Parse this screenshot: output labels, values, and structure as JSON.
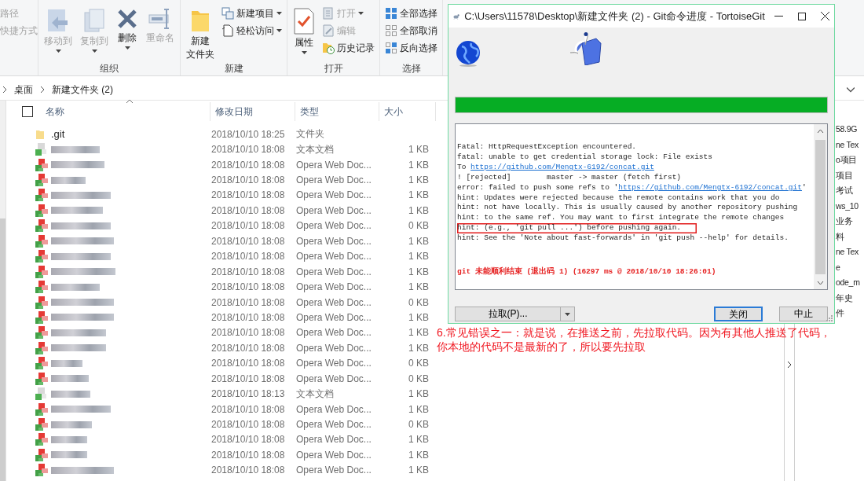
{
  "ribbon": {
    "groups": [
      {
        "items": [
          {
            "label": "路径",
            "kind": "small",
            "disabled": true,
            "dropdown": false
          },
          {
            "label": "快捷方式",
            "kind": "small",
            "disabled": true,
            "dropdown": false
          }
        ]
      },
      {
        "label": "组织",
        "items": [
          {
            "label": "移动到",
            "kind": "large",
            "disabled": true,
            "dropdown": true
          },
          {
            "label": "复制到",
            "kind": "large",
            "disabled": true,
            "dropdown": true
          },
          {
            "label": "删除",
            "kind": "large",
            "disabled": false,
            "dropdown": true
          },
          {
            "label": "重命名",
            "kind": "large",
            "disabled": true,
            "dropdown": false
          }
        ]
      },
      {
        "label": "新建",
        "items": [
          {
            "lines": [
              "新建",
              "文件夹"
            ],
            "kind": "large",
            "disabled": false,
            "dropdown": false
          },
          {
            "label": "新建项目",
            "kind": "small",
            "disabled": false,
            "dropdown": true
          },
          {
            "label": "轻松访问",
            "kind": "small",
            "disabled": false,
            "dropdown": true
          }
        ]
      },
      {
        "label": "打开",
        "items": [
          {
            "label": "属性",
            "kind": "large",
            "disabled": false,
            "dropdown": true
          },
          {
            "label": "打开",
            "kind": "small",
            "disabled": true,
            "dropdown": true
          },
          {
            "label": "编辑",
            "kind": "small",
            "disabled": true,
            "dropdown": false
          },
          {
            "label": "历史记录",
            "kind": "small",
            "disabled": false,
            "dropdown": false
          }
        ]
      },
      {
        "label": "选择",
        "items": [
          {
            "label": "全部选择",
            "kind": "small",
            "disabled": false,
            "dropdown": false
          },
          {
            "label": "全部取消",
            "kind": "small",
            "disabled": false,
            "dropdown": false
          },
          {
            "label": "反向选择",
            "kind": "small",
            "disabled": false,
            "dropdown": false
          }
        ]
      }
    ]
  },
  "breadcrumb": [
    "桌面",
    "新建文件夹 (2)"
  ],
  "table": {
    "select_all": {
      "checked": false
    },
    "columns": [
      {
        "label": "名称",
        "sorted": true
      },
      {
        "label": "修改日期",
        "sorted": false
      },
      {
        "label": "类型",
        "sorted": false
      },
      {
        "label": "大小",
        "sorted": false
      }
    ],
    "rows": [
      {
        "kind": "folder",
        "name": ".git",
        "modified": "2018/10/10 18:25",
        "type": "文件夹"
      },
      {
        "kind": "text",
        "modified": "2018/10/10 18:08",
        "type": "文本文档",
        "size": "1 KB"
      },
      {
        "kind": "web",
        "modified": "2018/10/10 18:08",
        "type": "Opera Web Doc...",
        "size": "1 KB"
      },
      {
        "kind": "web",
        "modified": "2018/10/10 18:08",
        "type": "Opera Web Doc...",
        "size": "1 KB"
      },
      {
        "kind": "web",
        "modified": "2018/10/10 18:08",
        "type": "Opera Web Doc...",
        "size": "1 KB"
      },
      {
        "kind": "web",
        "modified": "2018/10/10 18:08",
        "type": "Opera Web Doc...",
        "size": "1 KB"
      },
      {
        "kind": "web",
        "modified": "2018/10/10 18:08",
        "type": "Opera Web Doc...",
        "size": "0 KB"
      },
      {
        "kind": "web",
        "modified": "2018/10/10 18:08",
        "type": "Opera Web Doc...",
        "size": "1 KB"
      },
      {
        "kind": "web",
        "modified": "2018/10/10 18:08",
        "type": "Opera Web Doc...",
        "size": "1 KB"
      },
      {
        "kind": "web",
        "modified": "2018/10/10 18:08",
        "type": "Opera Web Doc...",
        "size": "1 KB"
      },
      {
        "kind": "web",
        "modified": "2018/10/10 18:08",
        "type": "Opera Web Doc...",
        "size": "1 KB"
      },
      {
        "kind": "web",
        "modified": "2018/10/10 18:08",
        "type": "Opera Web Doc...",
        "size": "0 KB"
      },
      {
        "kind": "web",
        "modified": "2018/10/10 18:08",
        "type": "Opera Web Doc...",
        "size": "1 KB"
      },
      {
        "kind": "web",
        "modified": "2018/10/10 18:08",
        "type": "Opera Web Doc...",
        "size": "1 KB"
      },
      {
        "kind": "web",
        "modified": "2018/10/10 18:08",
        "type": "Opera Web Doc...",
        "size": "1 KB"
      },
      {
        "kind": "web",
        "modified": "2018/10/10 18:08",
        "type": "Opera Web Doc...",
        "size": "0 KB"
      },
      {
        "kind": "web",
        "modified": "2018/10/10 18:08",
        "type": "Opera Web Doc...",
        "size": "0 KB"
      },
      {
        "kind": "text",
        "modified": "2018/10/10 18:13",
        "type": "文本文档",
        "size": "1 KB"
      },
      {
        "kind": "web",
        "modified": "2018/10/10 18:08",
        "type": "Opera Web Doc...",
        "size": "1 KB"
      },
      {
        "kind": "web",
        "modified": "2018/10/10 18:08",
        "type": "Opera Web Doc...",
        "size": "0 KB"
      },
      {
        "kind": "web",
        "modified": "2018/10/10 18:08",
        "type": "Opera Web Doc...",
        "size": "1 KB"
      },
      {
        "kind": "web",
        "modified": "2018/10/10 18:08",
        "type": "Opera Web Doc...",
        "size": "1 KB"
      },
      {
        "kind": "web",
        "modified": "2018/10/10 18:08",
        "type": "Opera Web Doc...",
        "size": "1 KB"
      }
    ]
  },
  "side_pane": {
    "items": [
      "58.9G",
      "ne Tex",
      "o项目",
      "项目",
      "考试",
      "ws_10",
      "业务",
      "料",
      "ne Tex",
      "e",
      "ode_m",
      "年史",
      "件"
    ]
  },
  "dialog": {
    "title": "C:\\Users\\11578\\Desktop\\新建文件夹 (2) - Git命令进度 - TortoiseGit",
    "progress": {
      "level": 1
    },
    "log": [
      {
        "highlighted": false,
        "parts": [
          {
            "kind": "text",
            "text": "Fatal: HttpRequestException encountered."
          }
        ]
      },
      {
        "highlighted": false,
        "parts": [
          {
            "kind": "text",
            "text": "fatal: unable to get credential storage lock: File exists"
          }
        ]
      },
      {
        "highlighted": false,
        "parts": [
          {
            "kind": "text",
            "text": "To "
          },
          {
            "kind": "link",
            "text": "https://github.com/Mengtx-6192/concat.git"
          }
        ]
      },
      {
        "highlighted": false,
        "parts": [
          {
            "kind": "text",
            "text": "! [rejected]        master -> master (fetch first)"
          }
        ]
      },
      {
        "highlighted": false,
        "parts": [
          {
            "kind": "text",
            "text": "error: failed to push some refs to '"
          },
          {
            "kind": "link",
            "text": "https://github.com/Mengtx-6192/concat.git"
          },
          {
            "kind": "text",
            "text": "'"
          }
        ]
      },
      {
        "highlighted": false,
        "parts": [
          {
            "kind": "text",
            "text": "hint: Updates were rejected because the remote contains work that you do"
          }
        ]
      },
      {
        "highlighted": false,
        "parts": [
          {
            "kind": "text",
            "text": "hint: not have locally. This is usually caused by another repository pushing"
          }
        ]
      },
      {
        "highlighted": false,
        "parts": [
          {
            "kind": "text",
            "text": "hint: to the same ref. You may want to first integrate the remote changes"
          }
        ]
      },
      {
        "highlighted": true,
        "parts": [
          {
            "kind": "text",
            "text": "hint: (e.g., 'git pull ...') before pushing again."
          }
        ]
      },
      {
        "highlighted": false,
        "parts": [
          {
            "kind": "text",
            "text": "hint: See the 'Note about fast-forwards' in 'git push --help' for details."
          }
        ]
      }
    ],
    "status": "git 未能顺利结束 (退出码 1) (16297 ms @ 2018/10/10 18:26:01)",
    "buttons": [
      {
        "label": "拉取(P)...",
        "kind": "split"
      },
      {
        "label": "关闭",
        "kind": "default"
      },
      {
        "label": "中止",
        "kind": "normal"
      }
    ]
  },
  "annotation": "6.常见错误之一：就是说，在推送之前，先拉取代码。因为有其他人推送了代码，你本地的代码不是最新的了，所以要先拉取"
}
